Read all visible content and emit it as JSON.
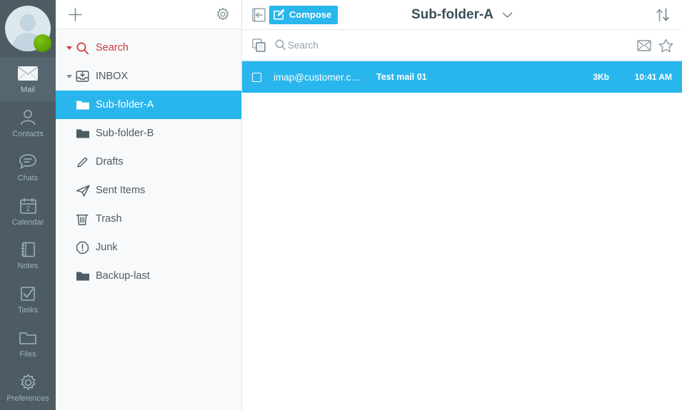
{
  "rail": {
    "avatar": {
      "name": "user-avatar",
      "status": "online",
      "status_color": "#5faa00"
    },
    "items": [
      {
        "label": "Mail",
        "icon": "mail-icon",
        "active": true
      },
      {
        "label": "Contacts",
        "icon": "contacts-icon",
        "active": false
      },
      {
        "label": "Chats",
        "icon": "chats-icon",
        "active": false
      },
      {
        "label": "Calendar",
        "icon": "calendar-icon",
        "active": false
      },
      {
        "label": "Notes",
        "icon": "notes-icon",
        "active": false
      },
      {
        "label": "Tasks",
        "icon": "tasks-icon",
        "active": false
      },
      {
        "label": "Files",
        "icon": "files-icon",
        "active": false
      },
      {
        "label": "Preferences",
        "icon": "preferences-icon",
        "active": false
      }
    ]
  },
  "folder_panel": {
    "header": {
      "add_label": "+",
      "add_icon": "plus-icon",
      "settings_icon": "gear-icon"
    },
    "items": [
      {
        "label": "Search",
        "icon": "search-icon",
        "caret": true,
        "indent": 0,
        "selected": false,
        "accent": "#cf3a3a"
      },
      {
        "label": "INBOX",
        "icon": "inbox-icon",
        "caret": true,
        "indent": 0,
        "selected": false
      },
      {
        "label": "Sub-folder-A",
        "icon": "folder-icon",
        "caret": false,
        "indent": 1,
        "selected": true
      },
      {
        "label": "Sub-folder-B",
        "icon": "folder-icon",
        "caret": false,
        "indent": 1,
        "selected": false
      },
      {
        "label": "Drafts",
        "icon": "drafts-icon",
        "caret": false,
        "indent": 1,
        "selected": false
      },
      {
        "label": "Sent Items",
        "icon": "sent-icon",
        "caret": false,
        "indent": 1,
        "selected": false
      },
      {
        "label": "Trash",
        "icon": "trash-icon",
        "caret": false,
        "indent": 1,
        "selected": false
      },
      {
        "label": "Junk",
        "icon": "junk-icon",
        "caret": false,
        "indent": 1,
        "selected": false
      },
      {
        "label": "Backup-last",
        "icon": "folder-icon",
        "caret": false,
        "indent": 1,
        "selected": false
      }
    ]
  },
  "toolbar": {
    "collapse_icon": "collapse-panel-icon",
    "compose_label": "Compose",
    "compose_icon": "compose-pencil-icon",
    "folder_title": "Sub-folder-A",
    "folder_chevron_icon": "chevron-down-icon",
    "sort_icon": "sort-arrows-icon"
  },
  "list_header": {
    "select_all_icon": "select-all-icon",
    "search_icon": "search-icon",
    "search_placeholder": "Search",
    "mark_read_icon": "envelope-icon",
    "flag_icon": "star-icon"
  },
  "messages": [
    {
      "sender": "imap@customer.c…",
      "subject": "Test mail 01",
      "size": "3Kb",
      "time": "10:41 AM",
      "selected": true,
      "checked": false
    }
  ],
  "colors": {
    "accent": "#29b6ec",
    "rail_bg": "#4d5c63",
    "rail_active_bg": "#556670",
    "panel_bg": "#f7f9fa",
    "text_dark": "#4d5c63",
    "search_red": "#cf3a3a"
  }
}
